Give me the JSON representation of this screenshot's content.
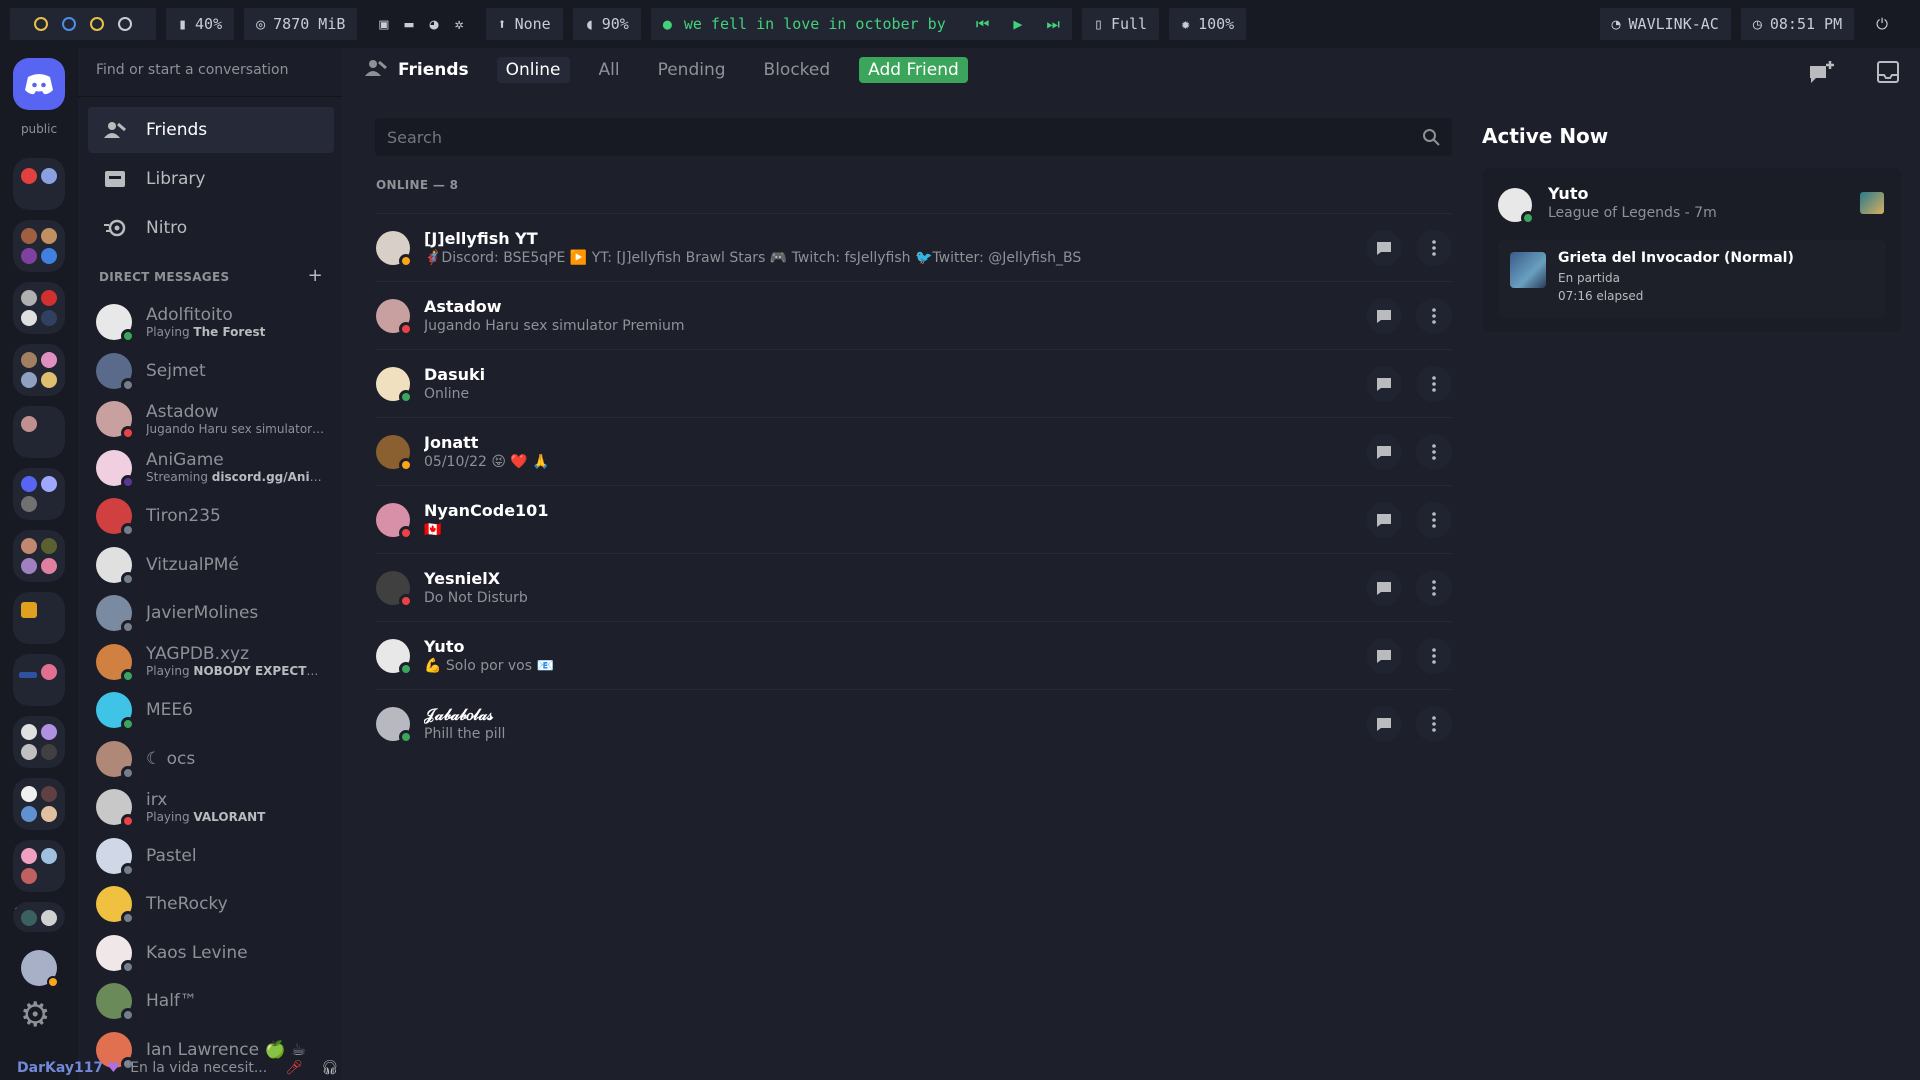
{
  "topbar": {
    "workspaces": [
      {
        "color": "#e5c04b"
      },
      {
        "color": "#4b8fe5"
      },
      {
        "color": "#e5c04b"
      },
      {
        "color": "#c9cbd6"
      }
    ],
    "cpu": "40%",
    "memory": "7870 MiB",
    "updates": "None",
    "volume": "90%",
    "now_playing": "we fell in love in october by ...",
    "battery": "Full",
    "brightness": "100%",
    "wifi": "WAVLINK-AC",
    "clock": "08:51 PM"
  },
  "servers": {
    "home_label": "public"
  },
  "dm_panel": {
    "search_placeholder": "Find or start a conversation",
    "nav": [
      {
        "label": "Friends",
        "icon": "friends-icon"
      },
      {
        "label": "Library",
        "icon": "library-icon"
      },
      {
        "label": "Nitro",
        "icon": "nitro-icon"
      }
    ],
    "header": "DIRECT MESSAGES",
    "add": "+",
    "dms": [
      {
        "name": "Adolfitoito",
        "sub_pre": "Playing ",
        "sub_bold": "The Forest",
        "status": "#3ba55c",
        "avatar": "#e8e8e8"
      },
      {
        "name": "Sejmet",
        "sub_pre": "",
        "sub_bold": "",
        "status": "#747f8d",
        "avatar": "#5a6a8a"
      },
      {
        "name": "Astadow",
        "sub_pre": "Jugando Haru sex simulator Pr...",
        "sub_bold": "",
        "status": "#ed4245",
        "avatar": "#c9a0a0"
      },
      {
        "name": "AniGame",
        "sub_pre": "Streaming ",
        "sub_bold": "discord.gg/AniGame",
        "status": "#593695",
        "avatar": "#f0d0e0"
      },
      {
        "name": "Tiron235",
        "sub_pre": "",
        "sub_bold": "",
        "status": "#747f8d",
        "avatar": "#d04040"
      },
      {
        "name": "VitzualPMé",
        "sub_pre": "",
        "sub_bold": "",
        "status": "#747f8d",
        "avatar": "#e0e0e0"
      },
      {
        "name": "JavierMolines",
        "sub_pre": "",
        "sub_bold": "",
        "status": "#747f8d",
        "avatar": "#7a8aa0"
      },
      {
        "name": "YAGPDB.xyz",
        "sub_pre": "Playing ",
        "sub_bold": "NOBODY EXPECTS T...",
        "status": "#3ba55c",
        "avatar": "#d08040"
      },
      {
        "name": "MEE6",
        "sub_pre": "",
        "sub_bold": "",
        "status": "#3ba55c",
        "avatar": "#3fc4e8"
      },
      {
        "name": "☾ ocs",
        "sub_pre": "",
        "sub_bold": "",
        "status": "#747f8d",
        "avatar": "#b08878"
      },
      {
        "name": "irx",
        "sub_pre": "Playing ",
        "sub_bold": "VALORANT",
        "status": "#ed4245",
        "avatar": "#c8c8c8"
      },
      {
        "name": "Pastel",
        "sub_pre": "",
        "sub_bold": "",
        "status": "#747f8d",
        "avatar": "#d0d8e8"
      },
      {
        "name": "TheRocky",
        "sub_pre": "",
        "sub_bold": "",
        "status": "#747f8d",
        "avatar": "#f0c040"
      },
      {
        "name": "Kaos Levine",
        "sub_pre": "",
        "sub_bold": "",
        "status": "#747f8d",
        "avatar": "#f0e8e8"
      },
      {
        "name": "Half™",
        "sub_pre": "",
        "sub_bold": "",
        "status": "#747f8d",
        "avatar": "#6a8a5a"
      },
      {
        "name": "Ian Lawrence 🍏 ☕",
        "sub_pre": "",
        "sub_bold": "",
        "status": "#747f8d",
        "avatar": "#e07050"
      }
    ],
    "user": {
      "name": "DarKay117",
      "status": "\"En la vida necesit..."
    }
  },
  "main": {
    "header": {
      "title": "Friends",
      "tabs": [
        "Online",
        "All",
        "Pending",
        "Blocked"
      ],
      "add_friend": "Add Friend"
    },
    "search_placeholder": "Search",
    "online_label": "ONLINE — 8",
    "friends": [
      {
        "name": "[J]ellyfish YT",
        "status": "🦸Discord: BSE5qPE ▶️ YT: [J]ellyfish Brawl Stars 🎮 Twitch: fsJellyfish 🐦Twitter: @Jellyfish_BS",
        "dot": "#faa61a",
        "avatar": "#d8d0c8"
      },
      {
        "name": "Astadow",
        "status": "Jugando Haru sex simulator Premium",
        "dot": "#ed4245",
        "avatar": "#c9a0a0"
      },
      {
        "name": "Dasuki",
        "status": "Online",
        "dot": "#3ba55c",
        "avatar": "#f0e0c0"
      },
      {
        "name": "Jonatt",
        "status": "05/10/22 😝 ❤️ 🙏",
        "dot": "#faa61a",
        "avatar": "#8a6030"
      },
      {
        "name": "NyanCode101",
        "status": "🇨🇦",
        "dot": "#ed4245",
        "avatar": "#d890a8"
      },
      {
        "name": "YesnielX",
        "status": "Do Not Disturb",
        "dot": "#ed4245",
        "avatar": "#404040"
      },
      {
        "name": "Yuto",
        "status": "💪 Solo por vos 📧",
        "dot": "#3ba55c",
        "avatar": "#e8e8e8"
      },
      {
        "name": "𝒥𝒶𝒷𝒶𝒷𝑜𝓁𝒶𝓈",
        "status": "Phill the pill",
        "dot": "#3ba55c",
        "avatar": "#b8b8c0"
      }
    ]
  },
  "active_now": {
    "title": "Active Now",
    "user": "Yuto",
    "activity": "League of Legends - 7m",
    "game_title": "Grieta del Invocador (Normal)",
    "game_state": "En partida",
    "elapsed": "07:16 elapsed"
  }
}
